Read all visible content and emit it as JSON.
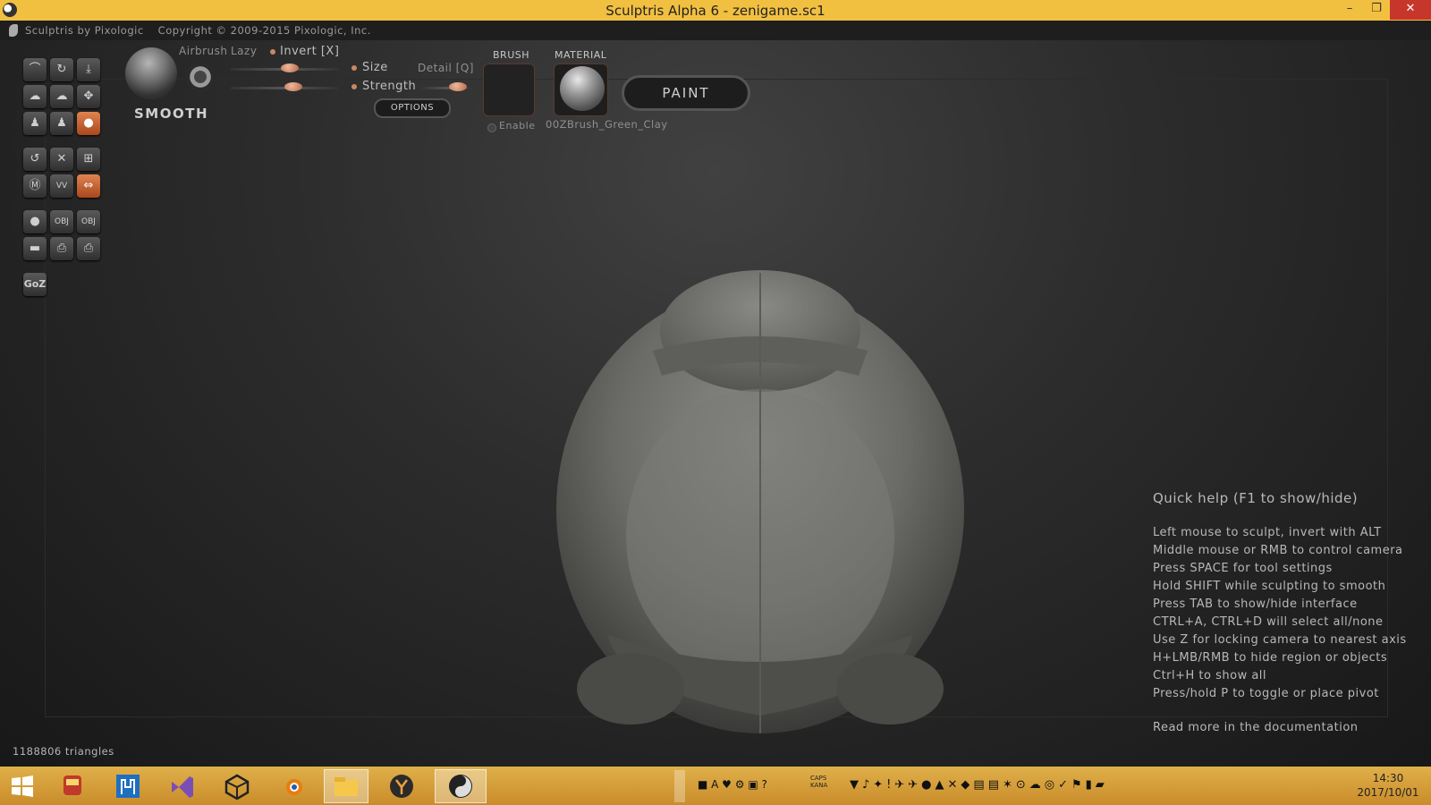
{
  "window": {
    "title": "Sculptris Alpha 6 - zenigame.sc1",
    "min_glyph": "–",
    "max_glyph": "❐",
    "close_glyph": "✕"
  },
  "infobar": {
    "brand": "Sculptris by Pixologic",
    "copyright": "Copyright © 2009-2015 Pixologic, Inc."
  },
  "tools": {
    "row1": [
      "⌒",
      "↻",
      "⤓"
    ],
    "row2": [
      "☁",
      "☁",
      "✥"
    ],
    "row3": [
      "♟",
      "♟",
      "●"
    ],
    "row4": [
      "↺",
      "✕",
      "⊞"
    ],
    "row5": [
      "Ⓜ",
      "VV",
      "⇔"
    ],
    "row6": [
      "●",
      "OBJ",
      "OBJ"
    ],
    "row7": [
      "▬",
      "⎙",
      "⎙"
    ],
    "goz": "GoZ"
  },
  "brush": {
    "name": "SMOOTH",
    "airbrush": "Airbrush",
    "lazy": "Lazy",
    "invert": "Invert [X]",
    "size": "Size",
    "strength": "Strength",
    "detail": "Detail [Q]",
    "options": "OPTIONS",
    "size_value": 0.55,
    "strength_value": 0.58,
    "detail_value": 0.7
  },
  "slots": {
    "brush_label": "BRUSH",
    "material_label": "MATERIAL",
    "enable": "Enable",
    "material_name": "00ZBrush_Green_Clay"
  },
  "paint_button": "PAINT",
  "quick_help": {
    "title": "Quick help (F1 to show/hide)",
    "lines": [
      "Left mouse to sculpt, invert with ALT",
      "Middle mouse or RMB to control camera",
      "Press SPACE for tool settings",
      "Hold SHIFT while sculpting to smooth",
      "Press TAB to show/hide interface",
      "CTRL+A, CTRL+D will select all/none",
      "Use Z for locking camera to nearest axis",
      "H+LMB/RMB to hide region or objects",
      "Ctrl+H to show all",
      "Press/hold P to toggle or place pivot"
    ],
    "more": "Read more in the documentation"
  },
  "status": {
    "triangles": "1188806 triangles"
  },
  "taskbar": {
    "apps": [
      "windows-start",
      "train-app",
      "store-app",
      "visual-studio",
      "unity",
      "blender",
      "file-explorer",
      "app-y",
      "sculptris"
    ],
    "clock_time": "14:30",
    "clock_date": "2017/10/01",
    "caps": "CAPS",
    "kana": "KANA"
  }
}
